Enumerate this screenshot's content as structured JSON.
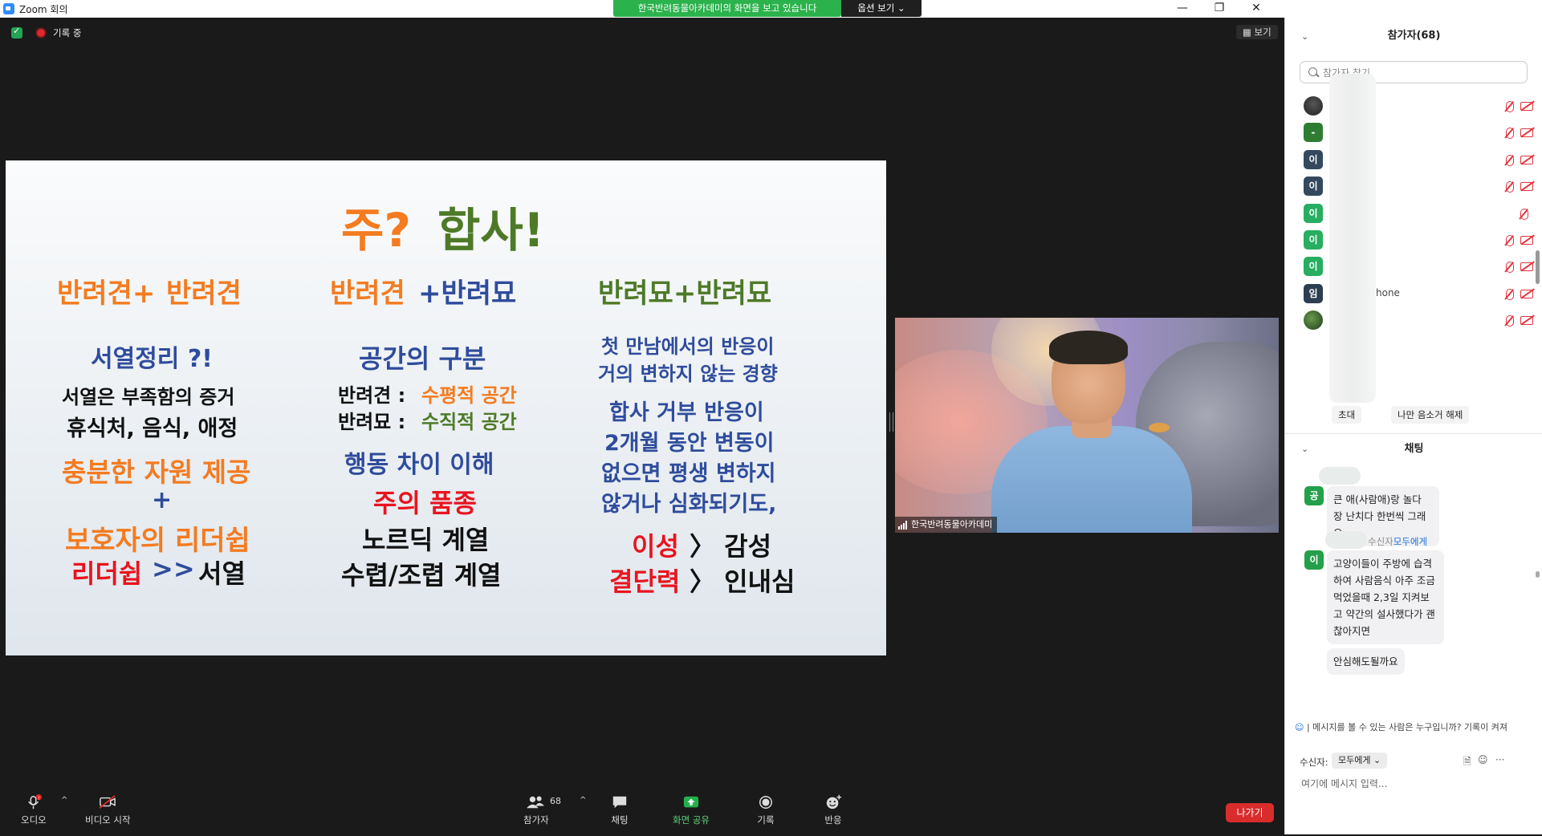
{
  "window": {
    "title": "Zoom 회의",
    "share_banner": "한국반려동물아카데미의 화면을 보고 있습니다",
    "view_options": "옵션 보기 ⌄",
    "minimize": "—",
    "maximize": "❐",
    "close": "✕"
  },
  "meeting": {
    "recording_label": "기록 중",
    "view_button": "▦ 보기"
  },
  "slide": {
    "title_q": "주?",
    "title_a": "합사!",
    "col1": {
      "header_a": "반려견+",
      "header_b": "반려견",
      "subhead": "서열정리 ?!",
      "line1": "서열은 부족함의 증거",
      "line2": "휴식처, 음식, 애정",
      "line3": "충분한 자원 제공",
      "plus": "+",
      "line4": "보호자의 리더쉽",
      "line5_a": "리더쉽",
      "line5_b": " >> ",
      "line5_c": "서열"
    },
    "col2": {
      "header_a": "반려견",
      "header_b": "+반려묘",
      "subhead": "공간의 구분",
      "line1_a": "반려견 : ",
      "line1_b": "수평적 공간",
      "line2_a": "반려묘 : ",
      "line2_b": "수직적 공간",
      "line3": "행동 차이 이해",
      "line4": "주의 품종",
      "line5": "노르딕 계열",
      "line6": "수렵/조렵 계열"
    },
    "col3": {
      "header": "반려묘+반려묘",
      "line1": "첫 만남에서의 반응이",
      "line2": "거의 변하지 않는 경향",
      "line3": "합사 거부 반응이",
      "line4": "2개월 동안 변동이",
      "line5": "없으면 평생 변하지",
      "line6": "않거나 심화되기도,",
      "line7_a": "이성",
      "line7_b": " 〉 감성",
      "line8_a": "결단력",
      "line8_b": " 〉 인내심"
    }
  },
  "video": {
    "name": "한국반려동물아카데미"
  },
  "toolbar": {
    "audio": "오디오",
    "video": "비디오 시작",
    "participants": "참가자",
    "participants_count": "68",
    "chat": "채팅",
    "share": "화면 공유",
    "record": "기록",
    "reactions": "반응",
    "leave": "나가기",
    "caret": "^"
  },
  "participants_panel": {
    "title": "참가자(68)",
    "search_placeholder": "참가자 찾기",
    "rows": [
      {
        "avatar": "",
        "name": "",
        "color": "#3a3a3a"
      },
      {
        "avatar": "-",
        "name": "",
        "color": "#2e7d32"
      },
      {
        "avatar": "이",
        "name": "",
        "color": "#34495e"
      },
      {
        "avatar": "이",
        "name": "",
        "color": "#34495e"
      },
      {
        "avatar": "이",
        "name": "",
        "color": "#27ae60"
      },
      {
        "avatar": "이",
        "name": "",
        "color": "#27ae60"
      },
      {
        "avatar": "이",
        "name": "",
        "color": "#27ae60"
      },
      {
        "avatar": "임",
        "name": "hone",
        "color": "#2c3e50"
      },
      {
        "avatar": "",
        "name": "",
        "color": "#2d5a2d"
      }
    ],
    "invite": "초대",
    "unmute_me": "나만 음소거 해제"
  },
  "chat_panel": {
    "title": "채팅",
    "msg1": {
      "avatar": "공",
      "text": "큰 애(사람애)랑 놀다 장 난치다 한번씩 그래요"
    },
    "msg2": {
      "avatar": "이",
      "to_prefix": "수신자",
      "to_target": "모두에게",
      "text": "고양이들이 주방에 습격하여 사람음식 아주 조금 먹었을때 2,3일 지켜보고 약간의 설사했다가 괜찮아지면",
      "text2": "안심해도될까요"
    },
    "notice": "| 메시지를 볼 수 있는 사람은 누구입니까? 기록이 켜져",
    "recipient_label": "수신자:",
    "recipient_value": "모두에게 ⌄",
    "input_placeholder": "여기에 메시지 입력...",
    "more": "···"
  }
}
